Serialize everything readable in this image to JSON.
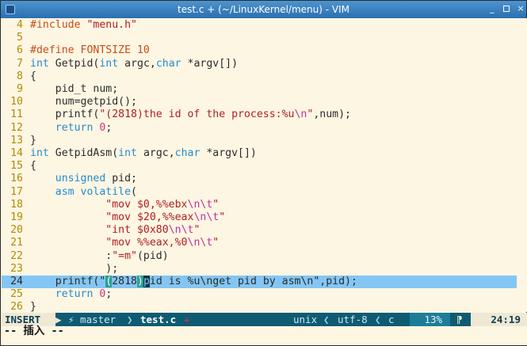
{
  "window": {
    "title": "test.c + (~/LinuxKernel/menu) - VIM",
    "controls": {
      "minimize": "_",
      "maximize": "□",
      "close": "×"
    }
  },
  "colors": {
    "linenr": "#b58900",
    "keyword": "#268bd2",
    "preproc": "#cb4b16",
    "string": "#b02020",
    "current_line_bg": "#84c6f3",
    "statusline_bg": "#0e5b73"
  },
  "editor": {
    "lines": [
      {
        "n": "4",
        "tokens": [
          {
            "t": "#include ",
            "c": "pp"
          },
          {
            "t": "\"menu.h\"",
            "c": "str"
          }
        ]
      },
      {
        "n": "5",
        "tokens": []
      },
      {
        "n": "6",
        "tokens": [
          {
            "t": "#define FONTSIZE 10",
            "c": "pp"
          }
        ]
      },
      {
        "n": "7",
        "tokens": [
          {
            "t": "int",
            "c": "kw"
          },
          {
            "t": " Getpid("
          },
          {
            "t": "int",
            "c": "kw"
          },
          {
            "t": " argc,"
          },
          {
            "t": "char",
            "c": "kw"
          },
          {
            "t": " *argv[])"
          }
        ]
      },
      {
        "n": "8",
        "tokens": [
          {
            "t": "{"
          }
        ]
      },
      {
        "n": "9",
        "tokens": [
          {
            "t": "    pid_t num;"
          }
        ]
      },
      {
        "n": "10",
        "tokens": [
          {
            "t": "    num=getpid();"
          }
        ]
      },
      {
        "n": "11",
        "tokens": [
          {
            "t": "    printf("
          },
          {
            "t": "\"(2818)the id of the process:%u",
            "c": "str"
          },
          {
            "t": "\\n",
            "c": "esc"
          },
          {
            "t": "\"",
            "c": "str"
          },
          {
            "t": ",num);"
          }
        ]
      },
      {
        "n": "12",
        "tokens": [
          {
            "t": "    "
          },
          {
            "t": "return",
            "c": "kw"
          },
          {
            "t": " "
          },
          {
            "t": "0",
            "c": "num"
          },
          {
            "t": ";"
          }
        ]
      },
      {
        "n": "13",
        "tokens": [
          {
            "t": "}"
          }
        ]
      },
      {
        "n": "14",
        "tokens": [
          {
            "t": "int",
            "c": "kw"
          },
          {
            "t": " GetpidAsm("
          },
          {
            "t": "int",
            "c": "kw"
          },
          {
            "t": " argc,"
          },
          {
            "t": "char",
            "c": "kw"
          },
          {
            "t": " *argv[])"
          }
        ]
      },
      {
        "n": "15",
        "tokens": [
          {
            "t": "{"
          }
        ]
      },
      {
        "n": "16",
        "tokens": [
          {
            "t": "    "
          },
          {
            "t": "unsigned",
            "c": "kw"
          },
          {
            "t": " pid;"
          }
        ]
      },
      {
        "n": "17",
        "tokens": [
          {
            "t": "    "
          },
          {
            "t": "asm volatile",
            "c": "kw"
          },
          {
            "t": "("
          }
        ]
      },
      {
        "n": "18",
        "tokens": [
          {
            "t": "            "
          },
          {
            "t": "\"mov $0,%%ebx",
            "c": "str"
          },
          {
            "t": "\\n\\t",
            "c": "esc"
          },
          {
            "t": "\"",
            "c": "str"
          }
        ]
      },
      {
        "n": "19",
        "tokens": [
          {
            "t": "            "
          },
          {
            "t": "\"mov $20,%%eax",
            "c": "str"
          },
          {
            "t": "\\n\\t",
            "c": "esc"
          },
          {
            "t": "\"",
            "c": "str"
          }
        ]
      },
      {
        "n": "20",
        "tokens": [
          {
            "t": "            "
          },
          {
            "t": "\"int $0x80",
            "c": "str"
          },
          {
            "t": "\\n\\t",
            "c": "esc"
          },
          {
            "t": "\"",
            "c": "str"
          }
        ]
      },
      {
        "n": "21",
        "tokens": [
          {
            "t": "            "
          },
          {
            "t": "\"mov %%eax,%0",
            "c": "str"
          },
          {
            "t": "\\n\\t",
            "c": "esc"
          },
          {
            "t": "\"",
            "c": "str"
          }
        ]
      },
      {
        "n": "22",
        "tokens": [
          {
            "t": "            :"
          },
          {
            "t": "\"=m\"",
            "c": "str"
          },
          {
            "t": "(pid)"
          }
        ]
      },
      {
        "n": "23",
        "tokens": [
          {
            "t": "            );"
          }
        ]
      },
      {
        "n": "24",
        "current": true,
        "tokens": [
          {
            "t": "    printf(\""
          },
          {
            "t": "(",
            "c": "par-hl"
          },
          {
            "t": "2818"
          },
          {
            "t": ")",
            "c": "par-hl"
          },
          {
            "t": "p",
            "c": "cursor"
          },
          {
            "t": "id is %u\\nget pid by asm\\n\",pid);"
          }
        ]
      },
      {
        "n": "25",
        "tokens": [
          {
            "t": "    "
          },
          {
            "t": "return",
            "c": "kw"
          },
          {
            "t": " "
          },
          {
            "t": "0",
            "c": "num"
          },
          {
            "t": ";"
          }
        ]
      },
      {
        "n": "26",
        "tokens": [
          {
            "t": "}"
          }
        ]
      }
    ]
  },
  "statusline": {
    "mode": "INSERT",
    "arrow_right": "▶",
    "branch": "⚡ master",
    "sep1": "❯",
    "filename": "test.c",
    "modified": "+",
    "fileformat": "unix",
    "sep2": "❮",
    "encoding": "utf-8",
    "sep3": "❮",
    "filetype": "c",
    "percent": "13%",
    "flag": "⁋",
    "position": "24:19"
  },
  "cmdline": {
    "text": "-- 插入 --"
  }
}
